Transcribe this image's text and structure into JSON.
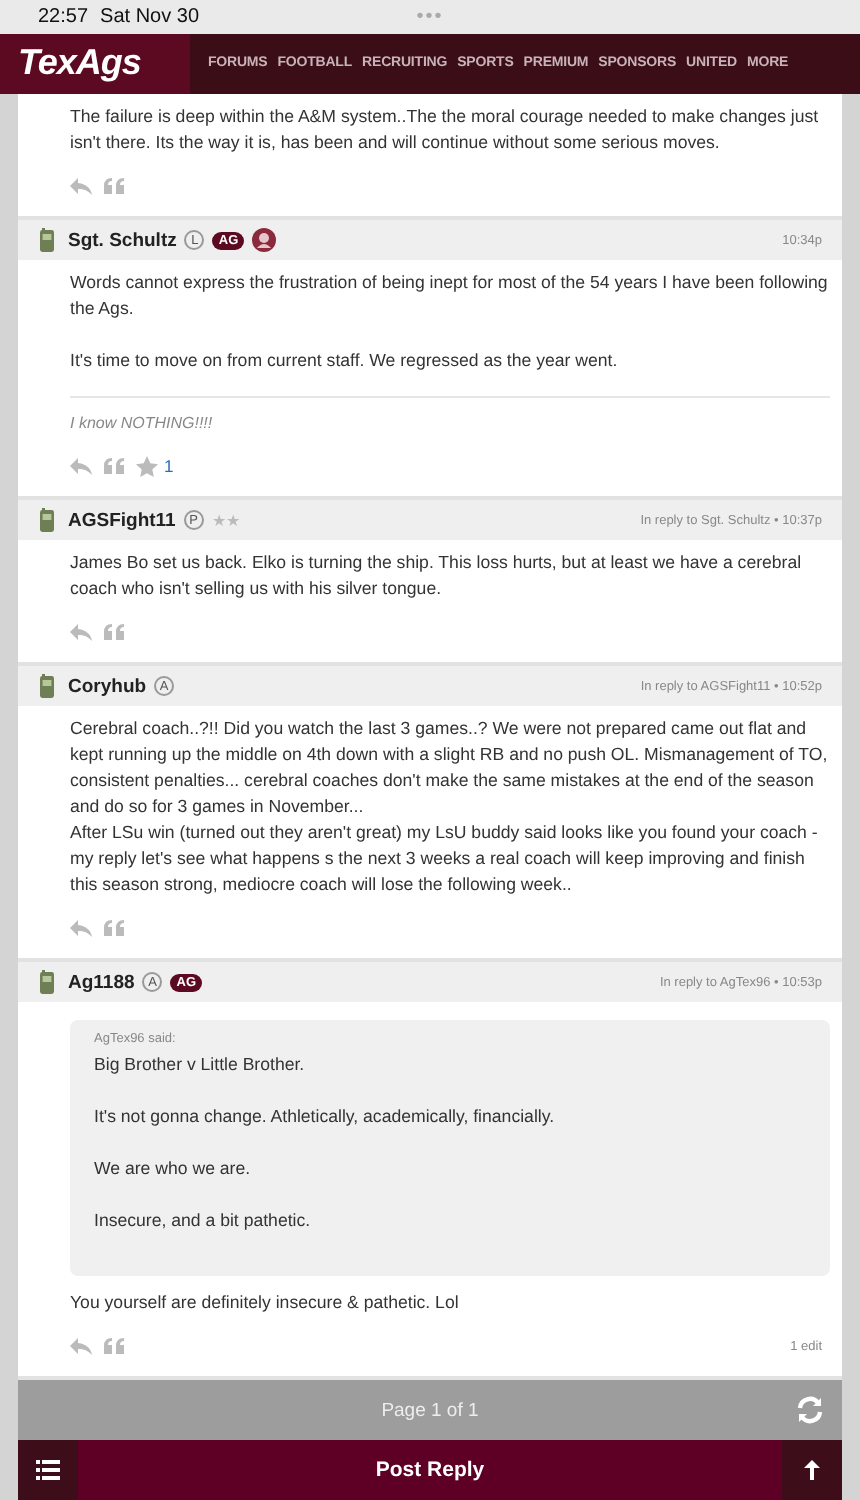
{
  "status_bar": {
    "time": "22:57",
    "date": "Sat Nov 30",
    "dots": "•••"
  },
  "header": {
    "logo": "TexAgs",
    "nav": [
      "FORUMS",
      "FOOTBALL",
      "RECRUITING",
      "SPORTS",
      "PREMIUM",
      "SPONSORS",
      "UNITED",
      "MORE"
    ]
  },
  "posts": [
    {
      "paragraphs": [
        "The failure is deep within the A&M system..The the moral courage needed to make changes just isn't there. Its the way it is, has been and will continue without some serious moves."
      ]
    },
    {
      "author": "Sgt. Schultz",
      "badges": [
        {
          "kind": "outline",
          "text": "L"
        },
        {
          "kind": "pill",
          "text": "AG"
        },
        {
          "kind": "emblem"
        }
      ],
      "meta": "10:34p",
      "paragraphs": [
        "Words cannot express the frustration of being inept for most of the 54 years I have been following the Ags.",
        "It's time to move on from current staff. We regressed as the year went."
      ],
      "signature": "I know NOTHING!!!!",
      "star_count": "1"
    },
    {
      "author": "AGSFight11",
      "badges": [
        {
          "kind": "outline",
          "text": "P"
        },
        {
          "kind": "stars",
          "text": "★★"
        }
      ],
      "meta": "In reply to Sgt. Schultz • 10:37p",
      "paragraphs": [
        "James Bo set us back. Elko is turning the ship. This loss hurts, but at least we have a cerebral coach who isn't selling us with his silver tongue."
      ]
    },
    {
      "author": "Coryhub",
      "badges": [
        {
          "kind": "outline",
          "text": "A"
        }
      ],
      "meta": "In reply to AGSFight11 • 10:52p",
      "paragraphs": [
        "Cerebral coach..?!! Did you watch the last 3 games..? We were not prepared came out flat and kept running up the middle on 4th down with a slight RB and no push OL. Mismanagement of TO, consistent penalties... cerebral coaches don't make the same mistakes at the end of the season and do so for 3 games in November...\nAfter LSu win (turned out they aren't great) my LsU buddy said looks like you found your coach - my reply let's see what happens s the next 3 weeks a real coach will keep improving and finish this season strong, mediocre coach will lose the following week.."
      ]
    },
    {
      "author": "Ag1188",
      "badges": [
        {
          "kind": "outline",
          "text": "A"
        },
        {
          "kind": "pill",
          "text": "AG"
        }
      ],
      "meta": "In reply to AgTex96 • 10:53p",
      "quote": {
        "attribution": "AgTex96 said:",
        "paragraphs": [
          "Big Brother v Little Brother.",
          "It's not gonna change. Athletically, academically, financially.",
          "We are who we are.",
          "Insecure, and a bit pathetic."
        ]
      },
      "paragraphs": [
        "You yourself are definitely insecure & pathetic. Lol"
      ],
      "edit_note": "1 edit"
    }
  ],
  "pager": {
    "label": "Page 1 of 1"
  },
  "bottom_bar": {
    "button": "Post Reply"
  }
}
